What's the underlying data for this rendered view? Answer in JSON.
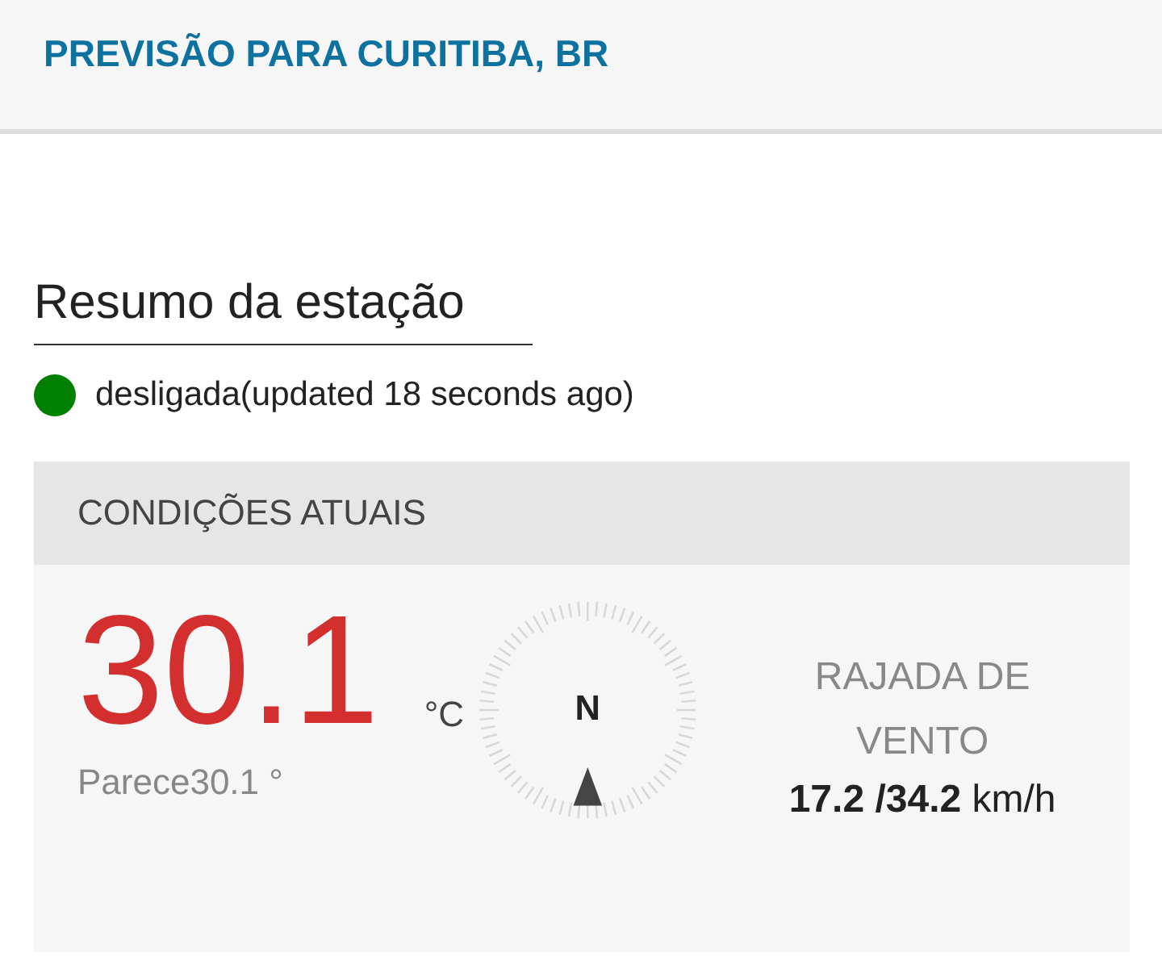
{
  "header": {
    "title": "PREVISÃO PARA CURITIBA, BR"
  },
  "section": {
    "title": "Resumo da estação"
  },
  "status": {
    "text": "desligada(updated 18 seconds ago)",
    "color": "#008000"
  },
  "conditions": {
    "title": "CONDIÇÕES ATUAIS",
    "temperature": "30.1",
    "unit": "°C",
    "feels_like": "Parece30.1 °",
    "compass_label": "N",
    "wind_title": "RAJADA DE VENTO",
    "wind_value": "**17.2 /34.2** km/h"
  }
}
